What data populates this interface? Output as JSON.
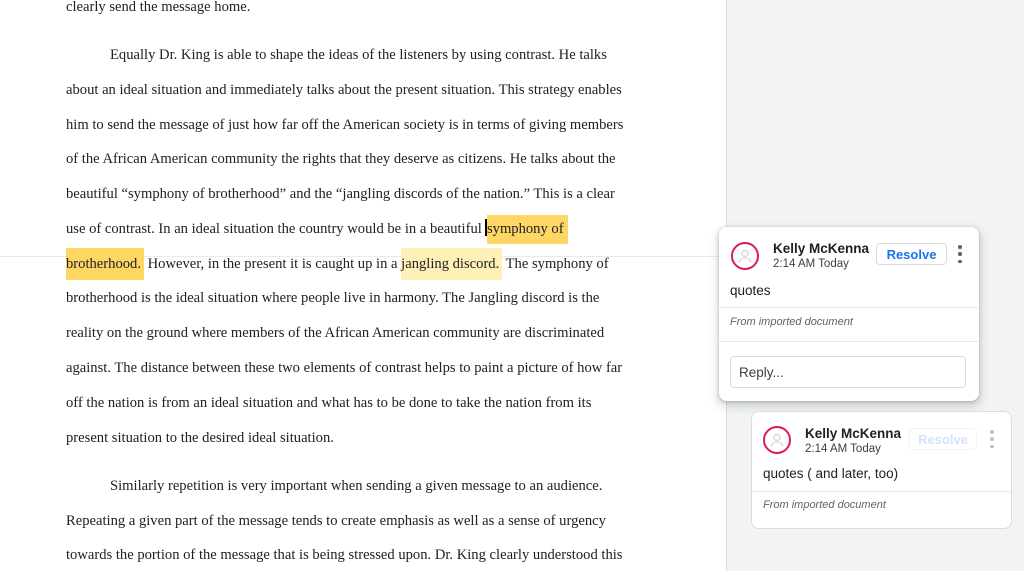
{
  "document": {
    "lines": [
      "clearly send the message home.",
      "Equally Dr. King is able to shape the ideas of the listeners by using contrast. He talks",
      "about an ideal situation and immediately talks about the present situation. This strategy enables",
      "him to send the message of just how far off the American society is in terms of giving members",
      "of the African American community the rights that they deserve as citizens. He talks about the",
      "beautiful “symphony of brotherhood” and the “jangling discords of the nation.” This is a clear"
    ],
    "line7": {
      "before": "use of contrast. In an ideal situation the country would be in a beautiful ",
      "highlight": "symphony of"
    },
    "line8": {
      "highlight_a": "brotherhood.",
      "middle": " However, in the present it is caught up in a ",
      "highlight_b": "jangling discord.",
      "after": " The symphony of"
    },
    "lines_b": [
      "brotherhood is the ideal situation where people live in harmony. The Jangling discord is the",
      "reality on the ground where members of the African American community are discriminated",
      "against. The distance between these two elements of contrast helps to paint a picture of how far",
      "off the nation is from an ideal situation and what has to be done to take the nation from its",
      "present situation to the desired ideal situation.",
      "Similarly repetition is very important when sending a given message to an audience.",
      "Repeating a given part of the message tends to create emphasis as well as a sense of urgency",
      "towards the portion of the message that is being stressed upon. Dr. King clearly understood this"
    ]
  },
  "comments": [
    {
      "author": "Kelly McKenna",
      "time": "2:14 AM Today",
      "resolve_label": "Resolve",
      "text": "quotes",
      "source": "From imported document",
      "reply_placeholder": "Reply..."
    },
    {
      "author": "Kelly McKenna",
      "time": "2:14 AM Today",
      "resolve_label": "Resolve",
      "text": "quotes ( and later, too)",
      "source": "From imported document"
    }
  ],
  "colors": {
    "highlight_active": "#fdd663",
    "highlight": "#fef1b8",
    "avatar_ring": "#d81b60",
    "accent": "#1a73e8"
  },
  "icons": [
    "person-avatar-icon",
    "more-vert-icon"
  ]
}
